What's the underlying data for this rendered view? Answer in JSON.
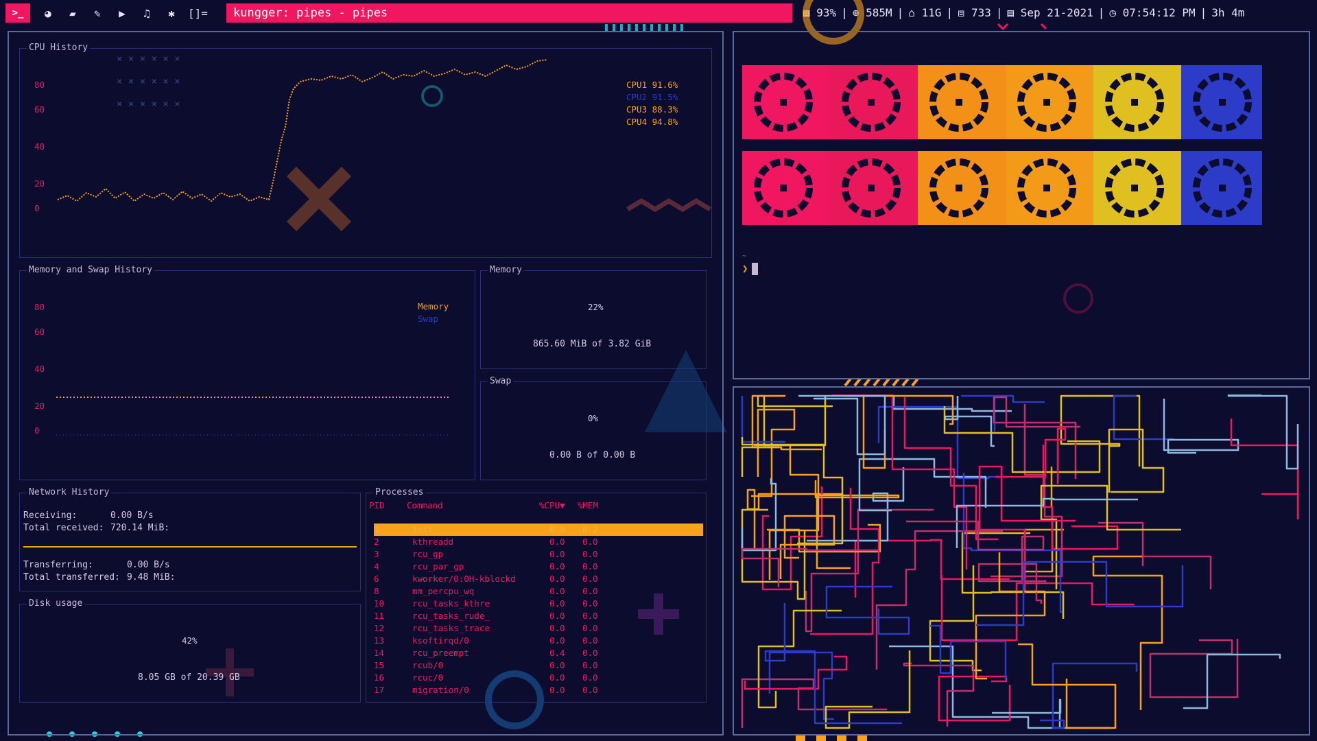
{
  "topbar": {
    "layout_symbol": "[]=",
    "window_title": "kungger: pipes - pipes",
    "status": {
      "cpu": "93%",
      "memory": "585M",
      "disk": "11G",
      "packages": "733",
      "date": "Sep 21-2021",
      "time": "07:54:12 PM",
      "uptime": "3h 4m"
    }
  },
  "cpu_history": {
    "title": "CPU History",
    "yticks": [
      "80",
      "60",
      "40",
      "20",
      "0"
    ],
    "legend": [
      {
        "label": "CPU1",
        "value": "91.6%",
        "color": "#f8a21b"
      },
      {
        "label": "CPU2",
        "value": "91.5%",
        "color": "#2c3cc8"
      },
      {
        "label": "CPU3",
        "value": "88.3%",
        "color": "#f8a21b"
      },
      {
        "label": "CPU4",
        "value": "94.8%",
        "color": "#f8a21b"
      }
    ]
  },
  "memory_swap_history": {
    "title": "Memory and Swap History",
    "yticks": [
      "80",
      "60",
      "40",
      "20",
      "0"
    ],
    "legend_memory": "Memory",
    "legend_swap": "Swap"
  },
  "memory": {
    "title": "Memory",
    "percent": "22%",
    "usage": "865.60 MiB of 3.82 GiB"
  },
  "swap": {
    "title": "Swap",
    "percent": "0%",
    "usage": "0.00 B of 0.00 B"
  },
  "network": {
    "title": "Network History",
    "receiving_label": "Receiving:",
    "receiving_value": "0.00 B/s",
    "total_received_label": "Total received:",
    "total_received_value": "720.14 MiB:",
    "transferring_label": "Transferring:",
    "transferring_value": "0.00 B/s",
    "total_transferred_label": "Total transferred:",
    "total_transferred_value": "9.48 MiB:"
  },
  "disk": {
    "title": "Disk usage",
    "percent": "42%",
    "usage": "8.05 GB of 20.39 GB"
  },
  "processes": {
    "title": "Processes",
    "headers": {
      "pid": "PID",
      "command": "Command",
      "cpu": "%CPU▼",
      "mem": "%MEM"
    },
    "rows": [
      {
        "pid": "1",
        "command": "test",
        "cpu": "0.0",
        "mem": "0.2"
      },
      {
        "pid": "2",
        "command": "kthreadd",
        "cpu": "0.0",
        "mem": "0.0"
      },
      {
        "pid": "3",
        "command": "rcu_gp",
        "cpu": "0.0",
        "mem": "0.0"
      },
      {
        "pid": "4",
        "command": "rcu_par_gp",
        "cpu": "0.0",
        "mem": "0.0"
      },
      {
        "pid": "6",
        "command": "kworker/0:0H-kblockd",
        "cpu": "0.0",
        "mem": "0.0"
      },
      {
        "pid": "8",
        "command": "mm_percpu_wq",
        "cpu": "0.0",
        "mem": "0.0"
      },
      {
        "pid": "10",
        "command": "rcu_tasks_kthre",
        "cpu": "0.0",
        "mem": "0.0"
      },
      {
        "pid": "11",
        "command": "rcu_tasks_rude_",
        "cpu": "0.0",
        "mem": "0.0"
      },
      {
        "pid": "12",
        "command": "rcu_tasks_trace",
        "cpu": "0.0",
        "mem": "0.0"
      },
      {
        "pid": "13",
        "command": "ksoftirqd/0",
        "cpu": "0.0",
        "mem": "0.0"
      },
      {
        "pid": "14",
        "command": "rcu_preempt",
        "cpu": "0.4",
        "mem": "0.0"
      },
      {
        "pid": "15",
        "command": "rcub/0",
        "cpu": "0.0",
        "mem": "0.0"
      },
      {
        "pid": "16",
        "command": "rcuc/0",
        "cpu": "0.0",
        "mem": "0.0"
      },
      {
        "pid": "17",
        "command": "migration/0",
        "cpu": "0.0",
        "mem": "0.0"
      }
    ]
  },
  "terminal": {
    "path": "~",
    "prompt": "❯"
  },
  "colors": {
    "background": "#0b0c2e",
    "accent_pink": "#f0165f",
    "accent_orange": "#f8a21b",
    "accent_yellow": "#e0c020",
    "accent_blue": "#2c3cc8"
  }
}
